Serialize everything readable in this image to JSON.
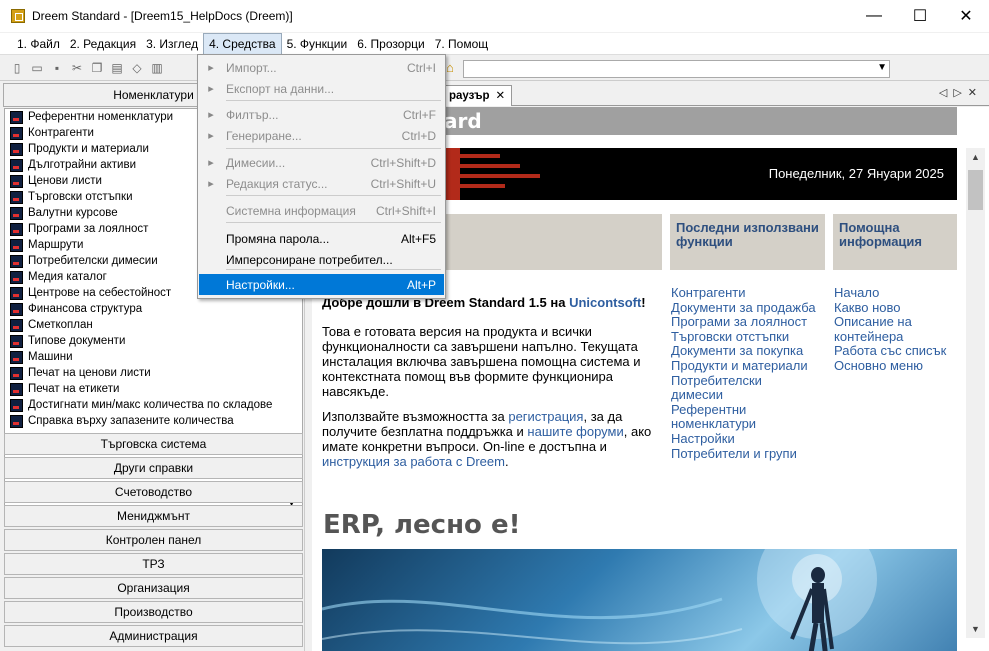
{
  "window": {
    "title": "Dreem Standard - [Dreem15_HelpDocs (Dreem)]",
    "minimize": "—",
    "maximize": "☐",
    "close": "✕"
  },
  "menu": [
    {
      "label": "1. Файл"
    },
    {
      "label": "2. Редакция"
    },
    {
      "label": "3. Изглед"
    },
    {
      "label": "4. Средства"
    },
    {
      "label": "5. Функции"
    },
    {
      "label": "6. Прозорци"
    },
    {
      "label": "7. Помощ"
    }
  ],
  "dropdown": {
    "items": [
      {
        "label": "Импорт...",
        "shortcut": "Ctrl+I",
        "icon": "import-icon",
        "state": "disabled"
      },
      {
        "label": "Експорт на данни...",
        "shortcut": "",
        "icon": "export-icon",
        "state": "disabled"
      },
      {
        "label": "Филтър...",
        "shortcut": "Ctrl+F",
        "icon": "filter-icon",
        "state": "disabled"
      },
      {
        "label": "Генериране...",
        "shortcut": "Ctrl+D",
        "icon": "generate-icon",
        "state": "disabled"
      },
      {
        "label": "Димесии...",
        "shortcut": "Ctrl+Shift+D",
        "icon": "dimensions-icon",
        "state": "disabled"
      },
      {
        "label": "Редакция статус...",
        "shortcut": "Ctrl+Shift+U",
        "icon": "status-icon",
        "state": "disabled"
      },
      {
        "label": "Системна информация",
        "shortcut": "Ctrl+Shift+I",
        "icon": "",
        "state": "disabled"
      },
      {
        "label": "Промяна парола...",
        "shortcut": "Alt+F5",
        "icon": "",
        "state": "enabled"
      },
      {
        "label": "Имперсониране потребител...",
        "shortcut": "",
        "icon": "",
        "state": "enabled"
      },
      {
        "label": "Настройки...",
        "shortcut": "Alt+P",
        "icon": "",
        "state": "selected"
      }
    ]
  },
  "left": {
    "header": "Номенклатури",
    "items": [
      "Референтни номенклатури",
      "Контрагенти",
      "Продукти и материали",
      "Дълготрайни активи",
      "Ценови листи",
      "Търговски отстъпки",
      "Валутни курсове",
      "Програми за лоялност",
      "Маршрути",
      "Потребителски димесии",
      "Медия каталог",
      "Центрове на себестойност",
      "Финансова структура",
      "Сметкоплан",
      "Типове документи",
      "Машини",
      "Печат на ценови листи",
      "Печат на етикети",
      "Достигнати мин/макс количества по складове",
      "Справка върху запазените количества"
    ],
    "groups": [
      "Търговска система",
      "Други справки",
      "Счетоводство",
      "Мениджмънт",
      "Контролен панел",
      "ТРЗ",
      "Организация",
      "Производство",
      "Администрация"
    ]
  },
  "browser": {
    "tab": "раузър",
    "tab_close": "✕",
    "banner_title": "ard",
    "date": "Понеделник, 27 Януари 2025",
    "box2_title": "Последни използвани функции",
    "box3_title": "Помощна информация",
    "welcome_title_1": "Добре дошли в Dreem Standard 1.5 на ",
    "welcome_title_link": "Unicontsoft",
    "welcome_title_end": "!",
    "para1": "Това е готовата версия на продукта и всички функционалности са завършени напълно. Текущата инсталация включва завършена помощна система и контекстната помощ във формите функционира навсякъде.",
    "para2_a": "Използвайте възможността за ",
    "para2_link1": "регистрация",
    "para2_b": ", за да получите безплатна поддръжка и ",
    "para2_link2": "нашите форуми",
    "para2_c": ", ако имате конкретни въпроси. On-line е достъпна и ",
    "para2_link3": "инструкция за работа с Dreem",
    "para2_d": ".",
    "recent_links": [
      "Контрагенти",
      "Документи за продажба",
      "Програми за лоялност",
      "Търговски отстъпки",
      "Документи за покупка",
      "Продукти и материали",
      "Потребителски",
      "димесии",
      "Референтни",
      "номенклатури",
      "Настройки",
      "Потребители и групи"
    ],
    "help_links": [
      "Начало",
      "Какво ново",
      "Описание на",
      "контейнера",
      "Работа със списък",
      "Основно меню"
    ],
    "erp_heading": "ERP, лесно е!"
  }
}
